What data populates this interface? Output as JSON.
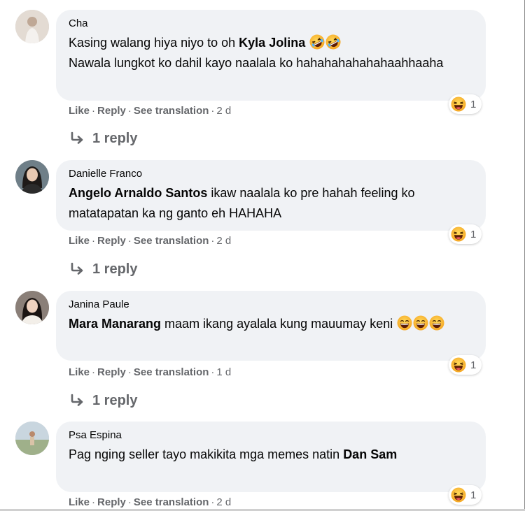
{
  "comments": [
    {
      "author": "Cha",
      "line1_pre": "Kasing walang hiya niyo to oh ",
      "line1_tag": "Kyla Jolina",
      "line1_post": "",
      "line2_pre": "Nawala lungkot ko dahil kayo naalala ko hahahahahahahaahhaaha",
      "line2_tag": "",
      "reaction_count": "1",
      "like": "Like",
      "reply": "Reply",
      "translate": "See translation",
      "time": "2 d",
      "replies": "1 reply",
      "avatar_color": "#d8cfc6"
    },
    {
      "author": "Danielle Franco",
      "line1_pre": "",
      "line1_tag": "Angelo Arnaldo Santos",
      "line1_post": " ikaw naalala ko pre hahah feeling ko matatapatan ka ng ganto eh HAHAHA",
      "line2_pre": "",
      "line2_tag": "",
      "reaction_count": "1",
      "like": "Like",
      "reply": "Reply",
      "translate": "See translation",
      "time": "2 d",
      "replies": "1 reply",
      "avatar_color": "#5a6a74"
    },
    {
      "author": "Janina Paule",
      "line1_pre": "",
      "line1_tag": "Mara Manarang",
      "line1_post": " maam ikang ayalala kung mauumay keni",
      "line2_pre": "",
      "line2_tag": "",
      "reaction_count": "1",
      "like": "Like",
      "reply": "Reply",
      "translate": "See translation",
      "time": "1 d",
      "replies": "1 reply",
      "avatar_color": "#3b3330"
    },
    {
      "author": "Psa Espina",
      "line1_pre": "Pag nging seller tayo makikita mga memes natin ",
      "line1_tag": "Dan Sam",
      "line1_post": "",
      "line2_pre": "",
      "line2_tag": "",
      "reaction_count": "1",
      "like": "Like",
      "reply": "Reply",
      "translate": "See translation",
      "time": "2 d",
      "replies": "",
      "avatar_color": "#9aa88e"
    }
  ],
  "icons": {
    "laughing": "laughing-emoji-icon",
    "rofl": "rolling-laughing-emoji-icon",
    "haha_reaction": "haha-reaction-icon",
    "reply_arrow": "reply-arrow-icon"
  },
  "colors": {
    "bubble": "#f0f2f5",
    "secondary_text": "#65676b",
    "emoji_yellow": "#f7b125"
  }
}
